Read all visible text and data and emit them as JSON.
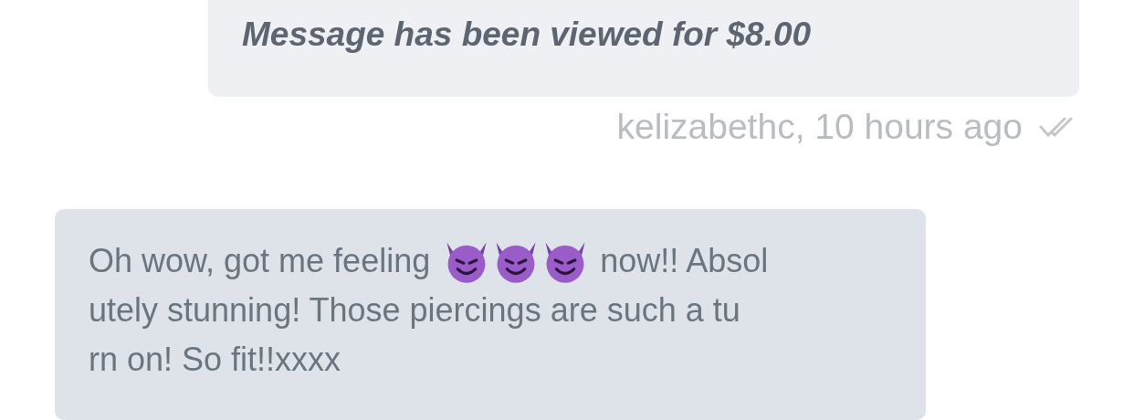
{
  "outgoing": {
    "text": "Message has been viewed for $8.00",
    "sender": "kelizabethc, 10 hours ago",
    "read": true
  },
  "incoming": {
    "lines": [
      [
        {
          "kind": "text",
          "text": "Oh wow, got me feeling"
        },
        {
          "kind": "emoji"
        },
        {
          "kind": "emoji"
        },
        {
          "kind": "emoji"
        },
        {
          "kind": "text",
          "text": "now!! Absol"
        }
      ],
      [
        {
          "kind": "text",
          "text": "utely stunning! Those piercings are such a tu"
        }
      ],
      [
        {
          "kind": "text",
          "text": "rn on! So fit!!xxxx"
        }
      ]
    ]
  }
}
